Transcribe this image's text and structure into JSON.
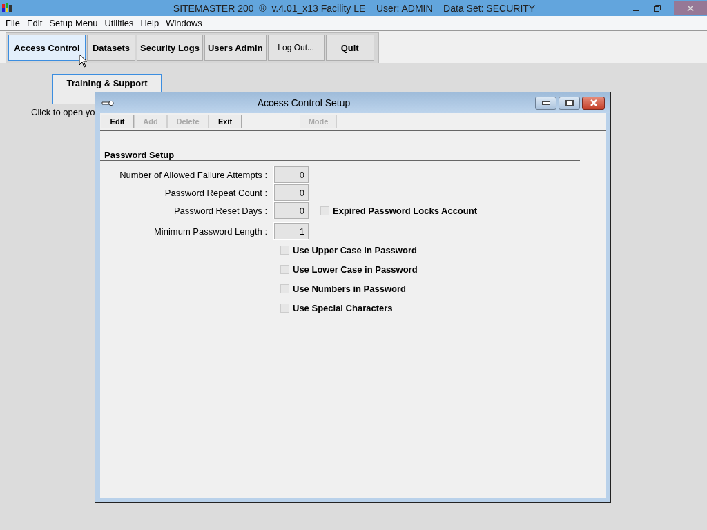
{
  "app_window": {
    "title": "SITEMASTER 200  ®  v.4.01_x13 Facility LE    User: ADMIN    Data Set: SECURITY"
  },
  "menu": [
    "File",
    "Edit",
    "Setup Menu",
    "Utilities",
    "Help",
    "Windows"
  ],
  "toolbar": [
    {
      "label": "Access Control",
      "selected": true
    },
    {
      "label": "Datasets",
      "selected": false
    },
    {
      "label": "Security Logs",
      "selected": false
    },
    {
      "label": "Users Admin",
      "selected": false
    },
    {
      "label": "Log Out...",
      "selected": false
    },
    {
      "label": "Quit",
      "selected": false
    }
  ],
  "main": {
    "training_button": "Training & Support",
    "caption": "Click to open yo"
  },
  "dialog": {
    "title": "Access Control Setup",
    "buttons": [
      {
        "label": "Edit",
        "disabled": false
      },
      {
        "label": "Add",
        "disabled": true
      },
      {
        "label": "Delete",
        "disabled": true
      },
      {
        "label": "Exit",
        "disabled": false
      },
      {
        "label": "Mode",
        "disabled": true
      }
    ],
    "section": "Password Setup",
    "fields": [
      {
        "label": "Number of Allowed Failure Attempts :",
        "value": "0"
      },
      {
        "label": "Password Repeat Count :",
        "value": "0"
      },
      {
        "label": "Password Reset Days :",
        "value": "0"
      },
      {
        "label": "Minimum Password Length :",
        "value": "1"
      }
    ],
    "side_option": {
      "label": "Expired Password Locks Account",
      "checked": false
    },
    "options": [
      {
        "label": "Use Upper Case in Password",
        "checked": false
      },
      {
        "label": "Use Lower Case in Password",
        "checked": false
      },
      {
        "label": "Use Numbers in Password",
        "checked": false
      },
      {
        "label": "Use Special Characters",
        "checked": false
      }
    ]
  }
}
